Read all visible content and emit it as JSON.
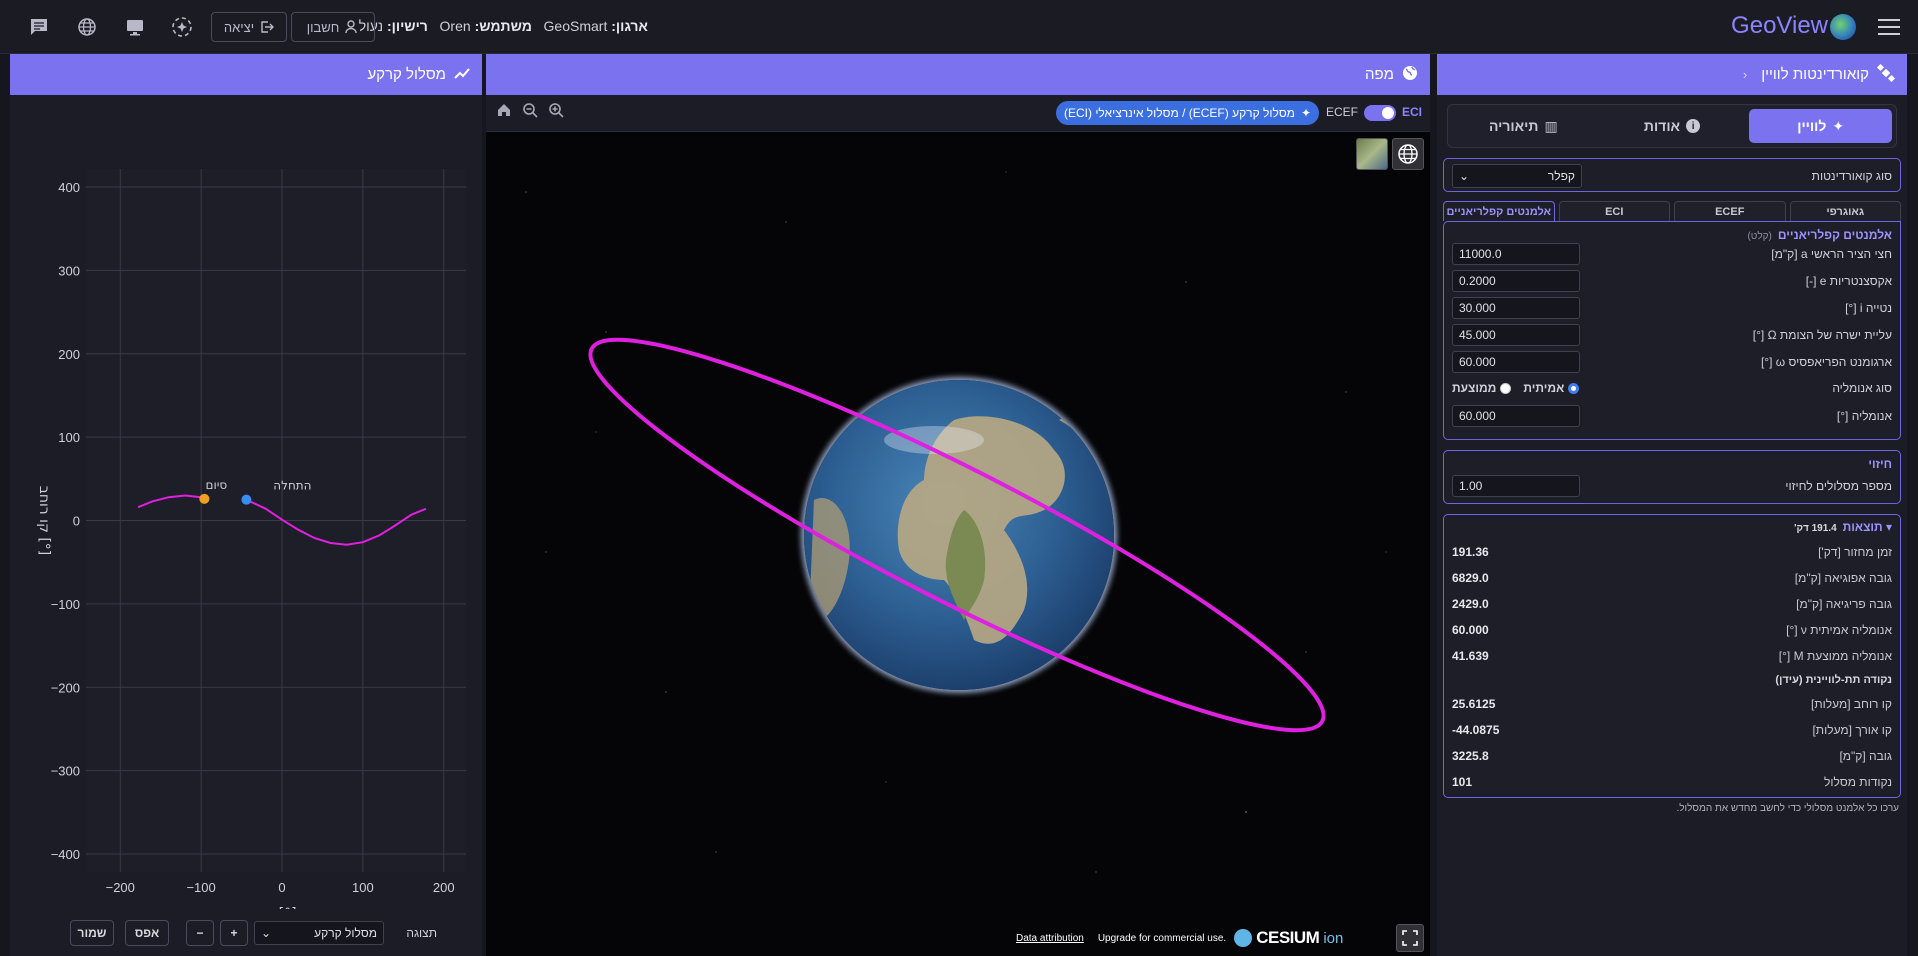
{
  "topbar": {
    "logo": "GeoView",
    "org_label": "ארגון:",
    "org_value": "GeoSmart",
    "user_label": "משתמש:",
    "user_value": "Oren",
    "license_label": "רישיון:",
    "license_value": "נעול",
    "account_label": "חשבון",
    "logout_label": "יציאה"
  },
  "right_panel": {
    "title": "קואורדינטות לוויין",
    "tabs": [
      {
        "label": "לוויין",
        "icon": "satellite-icon"
      },
      {
        "label": "אודות",
        "icon": "info-icon"
      },
      {
        "label": "תיאוריה",
        "icon": "book-icon"
      }
    ],
    "coord_type_label": "סוג קואורדינטות",
    "coord_type_value": "קפלר",
    "subtabs": [
      "גאוגרפי",
      "ECEF",
      "ECI",
      "אלמנטים קפלריאניים"
    ],
    "kepler": {
      "title": "אלמנטים קפלריאניים",
      "title_note": "(קלט)",
      "fields": [
        {
          "label": "חצי הציר הראשי a [ק\"מ]",
          "value": "11000.0"
        },
        {
          "label": "אקסצנטריות e [-]",
          "value": "0.2000"
        },
        {
          "label": "נטייה i [°]",
          "value": "30.000"
        },
        {
          "label": "עליית ישרה של הצומת Ω [°]",
          "value": "45.000"
        },
        {
          "label": "ארגומנט הפריאפסיס ω [°]",
          "value": "60.000"
        }
      ],
      "anomaly_type_label": "סוג אנומליה",
      "anomaly_true": "אמיתית",
      "anomaly_mean": "ממוצעת",
      "anomaly_label": "אנומליה [°]",
      "anomaly_value": "60.000"
    },
    "prediction": {
      "title": "חיזוי",
      "orbits_label": "מספר מסלולים לחיזוי",
      "orbits_value": "1.00"
    },
    "results": {
      "title": "תוצאות",
      "title_note": "191.4 דק'",
      "rows": [
        {
          "label": "זמן מחזור [דק']",
          "value": "191.36"
        },
        {
          "label": "גובה אפוגיאה [ק\"מ]",
          "value": "6829.0"
        },
        {
          "label": "גובה פריגיאה [ק\"מ]",
          "value": "2429.0"
        },
        {
          "label": "אנומליה אמיתית ν [°]",
          "value": "60.000"
        },
        {
          "label": "אנומליה ממוצעת M [°]",
          "value": "41.639"
        }
      ],
      "subsat_title": "נקודה תת-לוויינית (עידן)",
      "subsat_rows": [
        {
          "label": "קו רוחב [מעלות]",
          "value": "25.6125"
        },
        {
          "label": "קו אורך [מעלות]",
          "value": "-44.0875"
        },
        {
          "label": "גובה [ק\"מ]",
          "value": "3225.8"
        },
        {
          "label": "נקודות מסלול",
          "value": "101"
        }
      ]
    },
    "footnote": "ערכו כל אלמנט מסלולי כדי לחשב מחדש את המסלול."
  },
  "map_panel": {
    "title": "מפה",
    "eci_label": "ECI",
    "ecef_label": "ECEF",
    "mode_pill": "מסלול קרקע (ECEF) / מסלול אינרציאלי (ECI)",
    "cesium_brand": "CESIUM",
    "cesium_ion": "ion",
    "upgrade_text": "Upgrade for commercial use.",
    "attribution": "Data attribution"
  },
  "ground_panel": {
    "title": "מסלול קרקע",
    "display_label": "תצוגה",
    "display_value": "מסלול קרקע",
    "plus": "+",
    "minus": "−",
    "reset": "אפס",
    "save": "שמור",
    "colors": {
      "track": "#e020e0",
      "start": "#3a8cf0",
      "end": "#f0a020"
    }
  },
  "chart_data": {
    "type": "line",
    "xlabel": "קו אורך [°]",
    "ylabel": "קו רוחב [°]",
    "xlim": [
      -230,
      230
    ],
    "ylim": [
      -400,
      400
    ],
    "xticks": [
      -200,
      -100,
      0,
      100,
      200
    ],
    "yticks": [
      400,
      300,
      200,
      100,
      0,
      -100,
      -200,
      -300,
      -400
    ],
    "grid": true,
    "series": [
      {
        "segments": [
          {
            "x": [
              -44,
              -20,
              0,
              20,
              40,
              60,
              80,
              100,
              120,
              140,
              160,
              178
            ],
            "y": [
              25,
              14,
              1,
              -11,
              -21,
              -27,
              -29,
              -26,
              -18,
              -6,
              7,
              14
            ]
          },
          {
            "x": [
              -178,
              -160,
              -140,
              -120,
              -100,
              -96
            ],
            "y": [
              16,
              23,
              28,
              30,
              28,
              26
            ]
          }
        ]
      }
    ],
    "annotations": [
      {
        "text": "התחלה",
        "x": -44,
        "y": 25,
        "color": "#3a8cf0"
      },
      {
        "text": "סיום",
        "x": -96,
        "y": 26,
        "color": "#f0a020"
      }
    ]
  }
}
